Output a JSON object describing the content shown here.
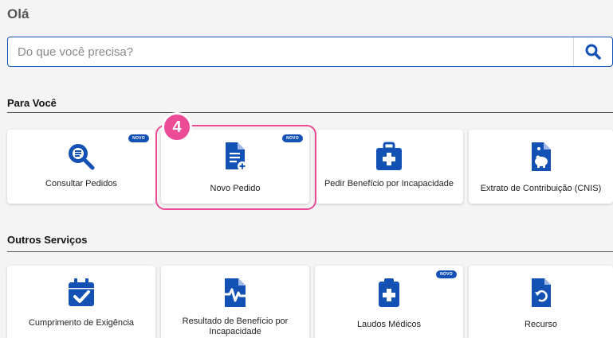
{
  "greeting": "Olá",
  "search": {
    "placeholder": "Do que você precisa?"
  },
  "sections": {
    "para_voce": "Para Você",
    "outros": "Outros Serviços"
  },
  "badge_text": "NOVO",
  "step_number": "4",
  "colors": {
    "accent": "#1351b4",
    "highlight": "#ec4b96"
  },
  "para_voce_cards": [
    {
      "label": "Consultar Pedidos",
      "icon": "search-document-icon",
      "badge": true
    },
    {
      "label": "Novo Pedido",
      "icon": "new-document-icon",
      "badge": true
    },
    {
      "label": "Pedir Benefício por Incapacidade",
      "icon": "medical-kit-icon",
      "badge": false
    },
    {
      "label": "Extrato de Contribuição (CNIS)",
      "icon": "piggy-bank-document-icon",
      "badge": false
    }
  ],
  "outros_cards": [
    {
      "label": "Cumprimento de Exigência",
      "icon": "calendar-check-icon",
      "badge": false
    },
    {
      "label": "Resultado de Benefício por Incapacidade",
      "icon": "heartbeat-document-icon",
      "badge": false
    },
    {
      "label": "Laudos Médicos",
      "icon": "medical-clipboard-icon",
      "badge": true
    },
    {
      "label": "Recurso",
      "icon": "undo-document-icon",
      "badge": false
    }
  ]
}
